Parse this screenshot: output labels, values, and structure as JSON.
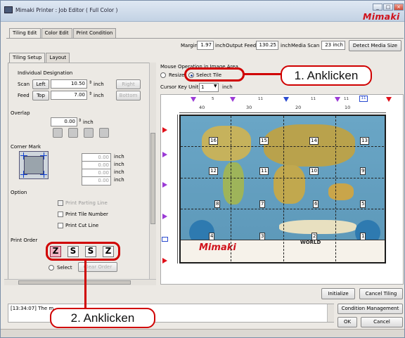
{
  "window": {
    "title": "Mimaki Printer : Job Editor ( Full Color )",
    "logo": "Mimaki"
  },
  "tabs": [
    "Tiling Edit",
    "Color Edit",
    "Print Condition"
  ],
  "media": {
    "margin_label": "Margin",
    "margin_value": "1.97",
    "margin_unit": "inch",
    "feed_label": "Output Feed",
    "feed_value": "130.25",
    "feed_unit": "inch",
    "scan_label": "Media Scan",
    "scan_value": "23 inch",
    "detect_button": "Detect Media Size"
  },
  "subtabs": [
    "Tiling Setup",
    "Layout"
  ],
  "individual": {
    "heading": "Individual Designation",
    "scan_label": "Scan",
    "scan_left": "Left",
    "scan_value": "10.50",
    "scan_unit": "inch",
    "scan_right": "Right",
    "feed_label": "Feed",
    "feed_top": "Top",
    "feed_value": "7.00",
    "feed_unit": "inch",
    "feed_bottom": "Bottom"
  },
  "overlap": {
    "heading": "Overlap",
    "value": "0.00",
    "unit": "inch"
  },
  "corner": {
    "heading": "Corner Mark",
    "values": [
      "0.00",
      "0.00",
      "0.00",
      "0.00"
    ],
    "unit": "inch"
  },
  "option": {
    "heading": "Option",
    "items": [
      {
        "label": "Print Parting Line",
        "enabled": false
      },
      {
        "label": "Print Tile Number",
        "enabled": true
      },
      {
        "label": "Print Cut Line",
        "enabled": true
      }
    ]
  },
  "print_order": {
    "heading": "Print Order",
    "select_label": "Select",
    "clear_label": "Clear Order",
    "buttons": [
      "Z",
      "S",
      "S",
      "Z"
    ]
  },
  "mouse": {
    "heading": "Mouse Operation in Image Area",
    "resize": "Resize",
    "select_tile": "Select Tile",
    "cursor_label": "Cursor Key Unit",
    "cursor_value": "1",
    "cursor_unit": "inch"
  },
  "ruler": {
    "top": [
      "40",
      "30",
      "20",
      "10"
    ],
    "top_small": [
      "5",
      "11",
      "11",
      "11"
    ],
    "top_box": "11"
  },
  "tiles": [
    "16",
    "15",
    "14",
    "13",
    "12",
    "11",
    "10",
    "9",
    "8",
    "7",
    "6",
    "5",
    "4",
    "3",
    "2",
    "1"
  ],
  "map_logo": "Mimaki",
  "map_text": "WORLD",
  "callouts": {
    "one": "1. Anklicken",
    "two": "2. Anklicken"
  },
  "bottom": {
    "initialize": "Initialize",
    "cancel_tiling": "Cancel Tiling",
    "status": "[13:34:07] The m",
    "condition": "Condition Management",
    "ok": "OK",
    "cancel": "Cancel"
  },
  "colors": {
    "accent_red": "#d00000",
    "tile_sel": "#f0b4c4"
  }
}
